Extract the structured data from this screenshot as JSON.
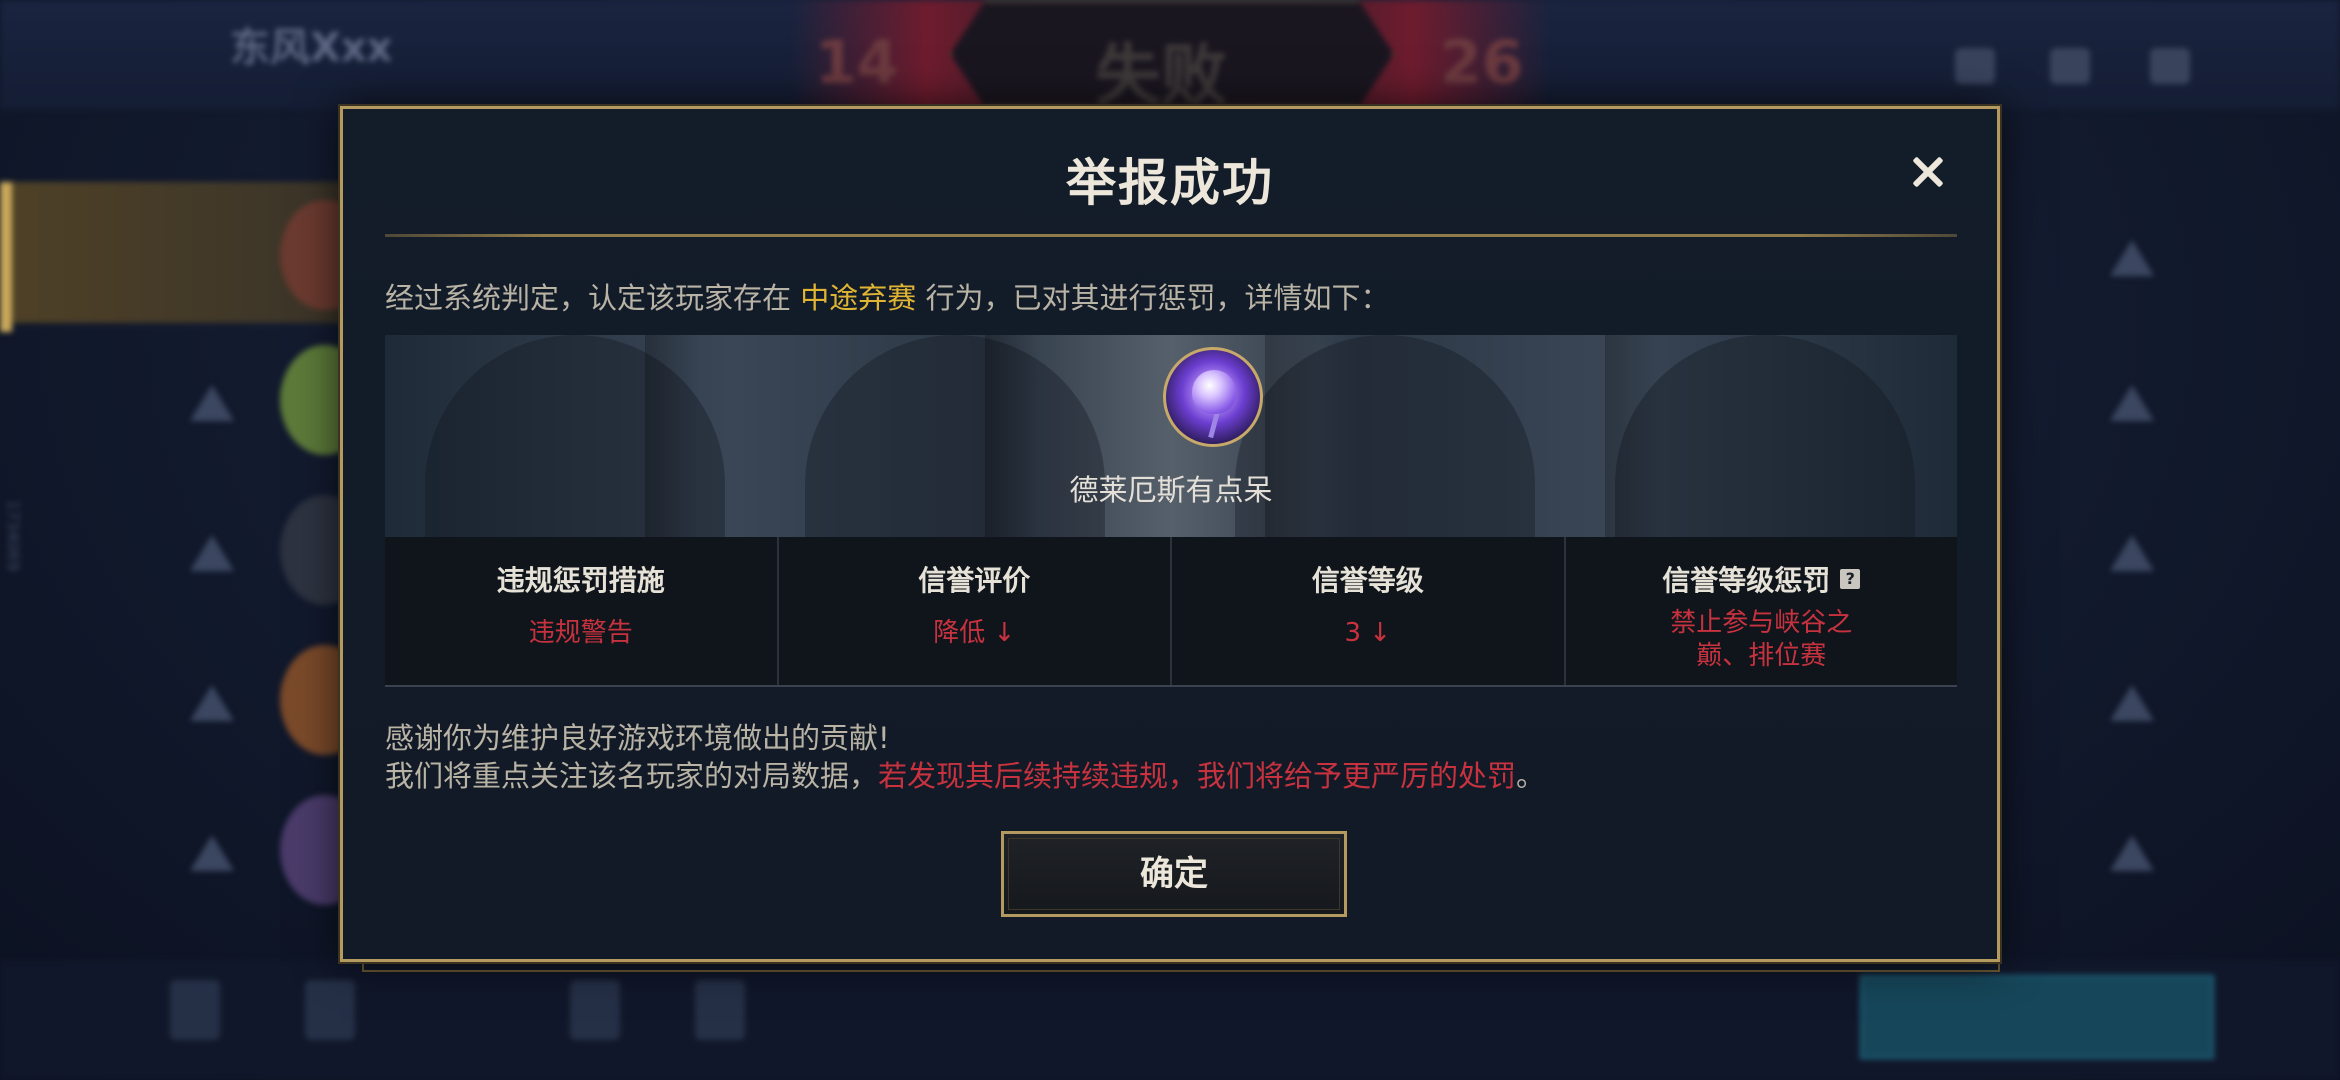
{
  "background": {
    "player_name": "东风Xxx",
    "player_sub": "",
    "score_left": "14",
    "score_center": "失败",
    "score_right": "26",
    "side_code": "1734069"
  },
  "dialog": {
    "title": "举报成功",
    "close_icon": "close-icon",
    "verdict": {
      "prefix": "经过系统判定，认定该玩家存在 ",
      "behavior": "中途弃赛",
      "suffix": " 行为，已对其进行惩罚，详情如下："
    },
    "player": {
      "name": "德莱厄斯有点呆",
      "avatar_icon": "rose-avatar-icon"
    },
    "penalties": [
      {
        "header": "违规惩罚措施",
        "value": "违规警告"
      },
      {
        "header": "信誉评价",
        "value": "降低 ↓"
      },
      {
        "header": "信誉等级",
        "value": "3 ↓"
      },
      {
        "header": "信誉等级惩罚",
        "help": "?",
        "value_line1": "禁止参与峡谷之",
        "value_line2": "巅、排位赛"
      }
    ],
    "thanks": {
      "line1": "感谢你为维护良好游戏环境做出的贡献!",
      "line2_prefix": "我们将重点关注该名玩家的对局数据，",
      "line2_highlight": "若发现其后续持续违规，我们将给予更严厉的处罚",
      "line2_suffix": "。"
    },
    "confirm_label": "确定"
  },
  "colors": {
    "gold_border": "#b49a5e",
    "highlight_gold": "#e1b534",
    "penalty_red": "#c8323f"
  }
}
